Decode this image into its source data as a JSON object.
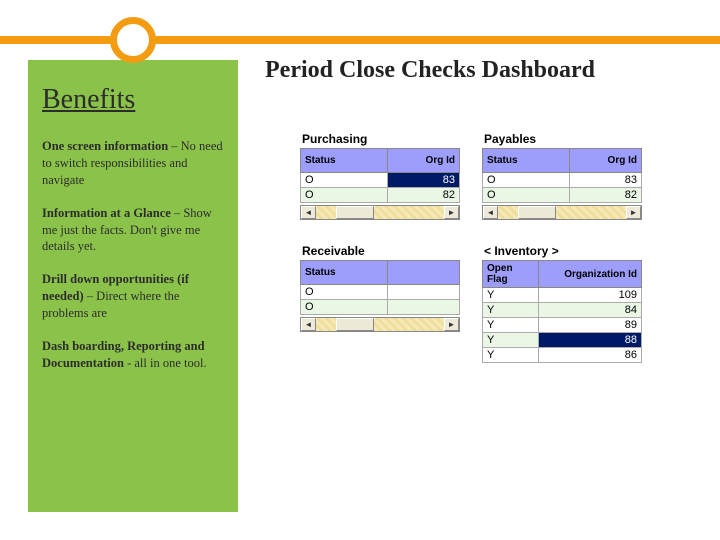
{
  "title": "Period Close Checks  Dashboard",
  "sidebar": {
    "heading": "Benefits",
    "items": [
      {
        "bold": "One screen information",
        "rest": " – No need to switch responsibilities and navigate"
      },
      {
        "bold": "Information at a Glance",
        "rest": " – Show me just the facts.  Don't give me details yet."
      },
      {
        "bold": "Drill down opportunities (if needed)",
        "rest": " – Direct where the problems are"
      },
      {
        "bold": "Dash boarding, Reporting and Documentation",
        "rest": " - all in one tool."
      }
    ]
  },
  "columns": {
    "status": "Status",
    "org": "Org Id",
    "openflag": "Open Flag",
    "orgid": "Organization Id"
  },
  "panels": {
    "purchasing": {
      "title": "Purchasing",
      "rows": [
        {
          "status": "O",
          "org": "83",
          "hl": true
        },
        {
          "status": "O",
          "org": "82",
          "hl": false
        }
      ]
    },
    "payables": {
      "title": "Payables",
      "rows": [
        {
          "status": "O",
          "org": "83",
          "hl": false
        },
        {
          "status": "O",
          "org": "82",
          "hl": false
        }
      ]
    },
    "receivable": {
      "title": "Receivable",
      "rows": [
        {
          "status": "O",
          "org": "",
          "hl": false
        },
        {
          "status": "O",
          "org": "",
          "hl": false
        }
      ]
    },
    "inventory": {
      "title": "< Inventory >",
      "rows": [
        {
          "flag": "Y",
          "org": "109"
        },
        {
          "flag": "Y",
          "org": "84"
        },
        {
          "flag": "Y",
          "org": "89"
        },
        {
          "flag": "Y",
          "org": "88",
          "hl": true
        },
        {
          "flag": "Y",
          "org": "86"
        }
      ]
    }
  },
  "glyph": {
    "left": "◄",
    "right": "►"
  }
}
